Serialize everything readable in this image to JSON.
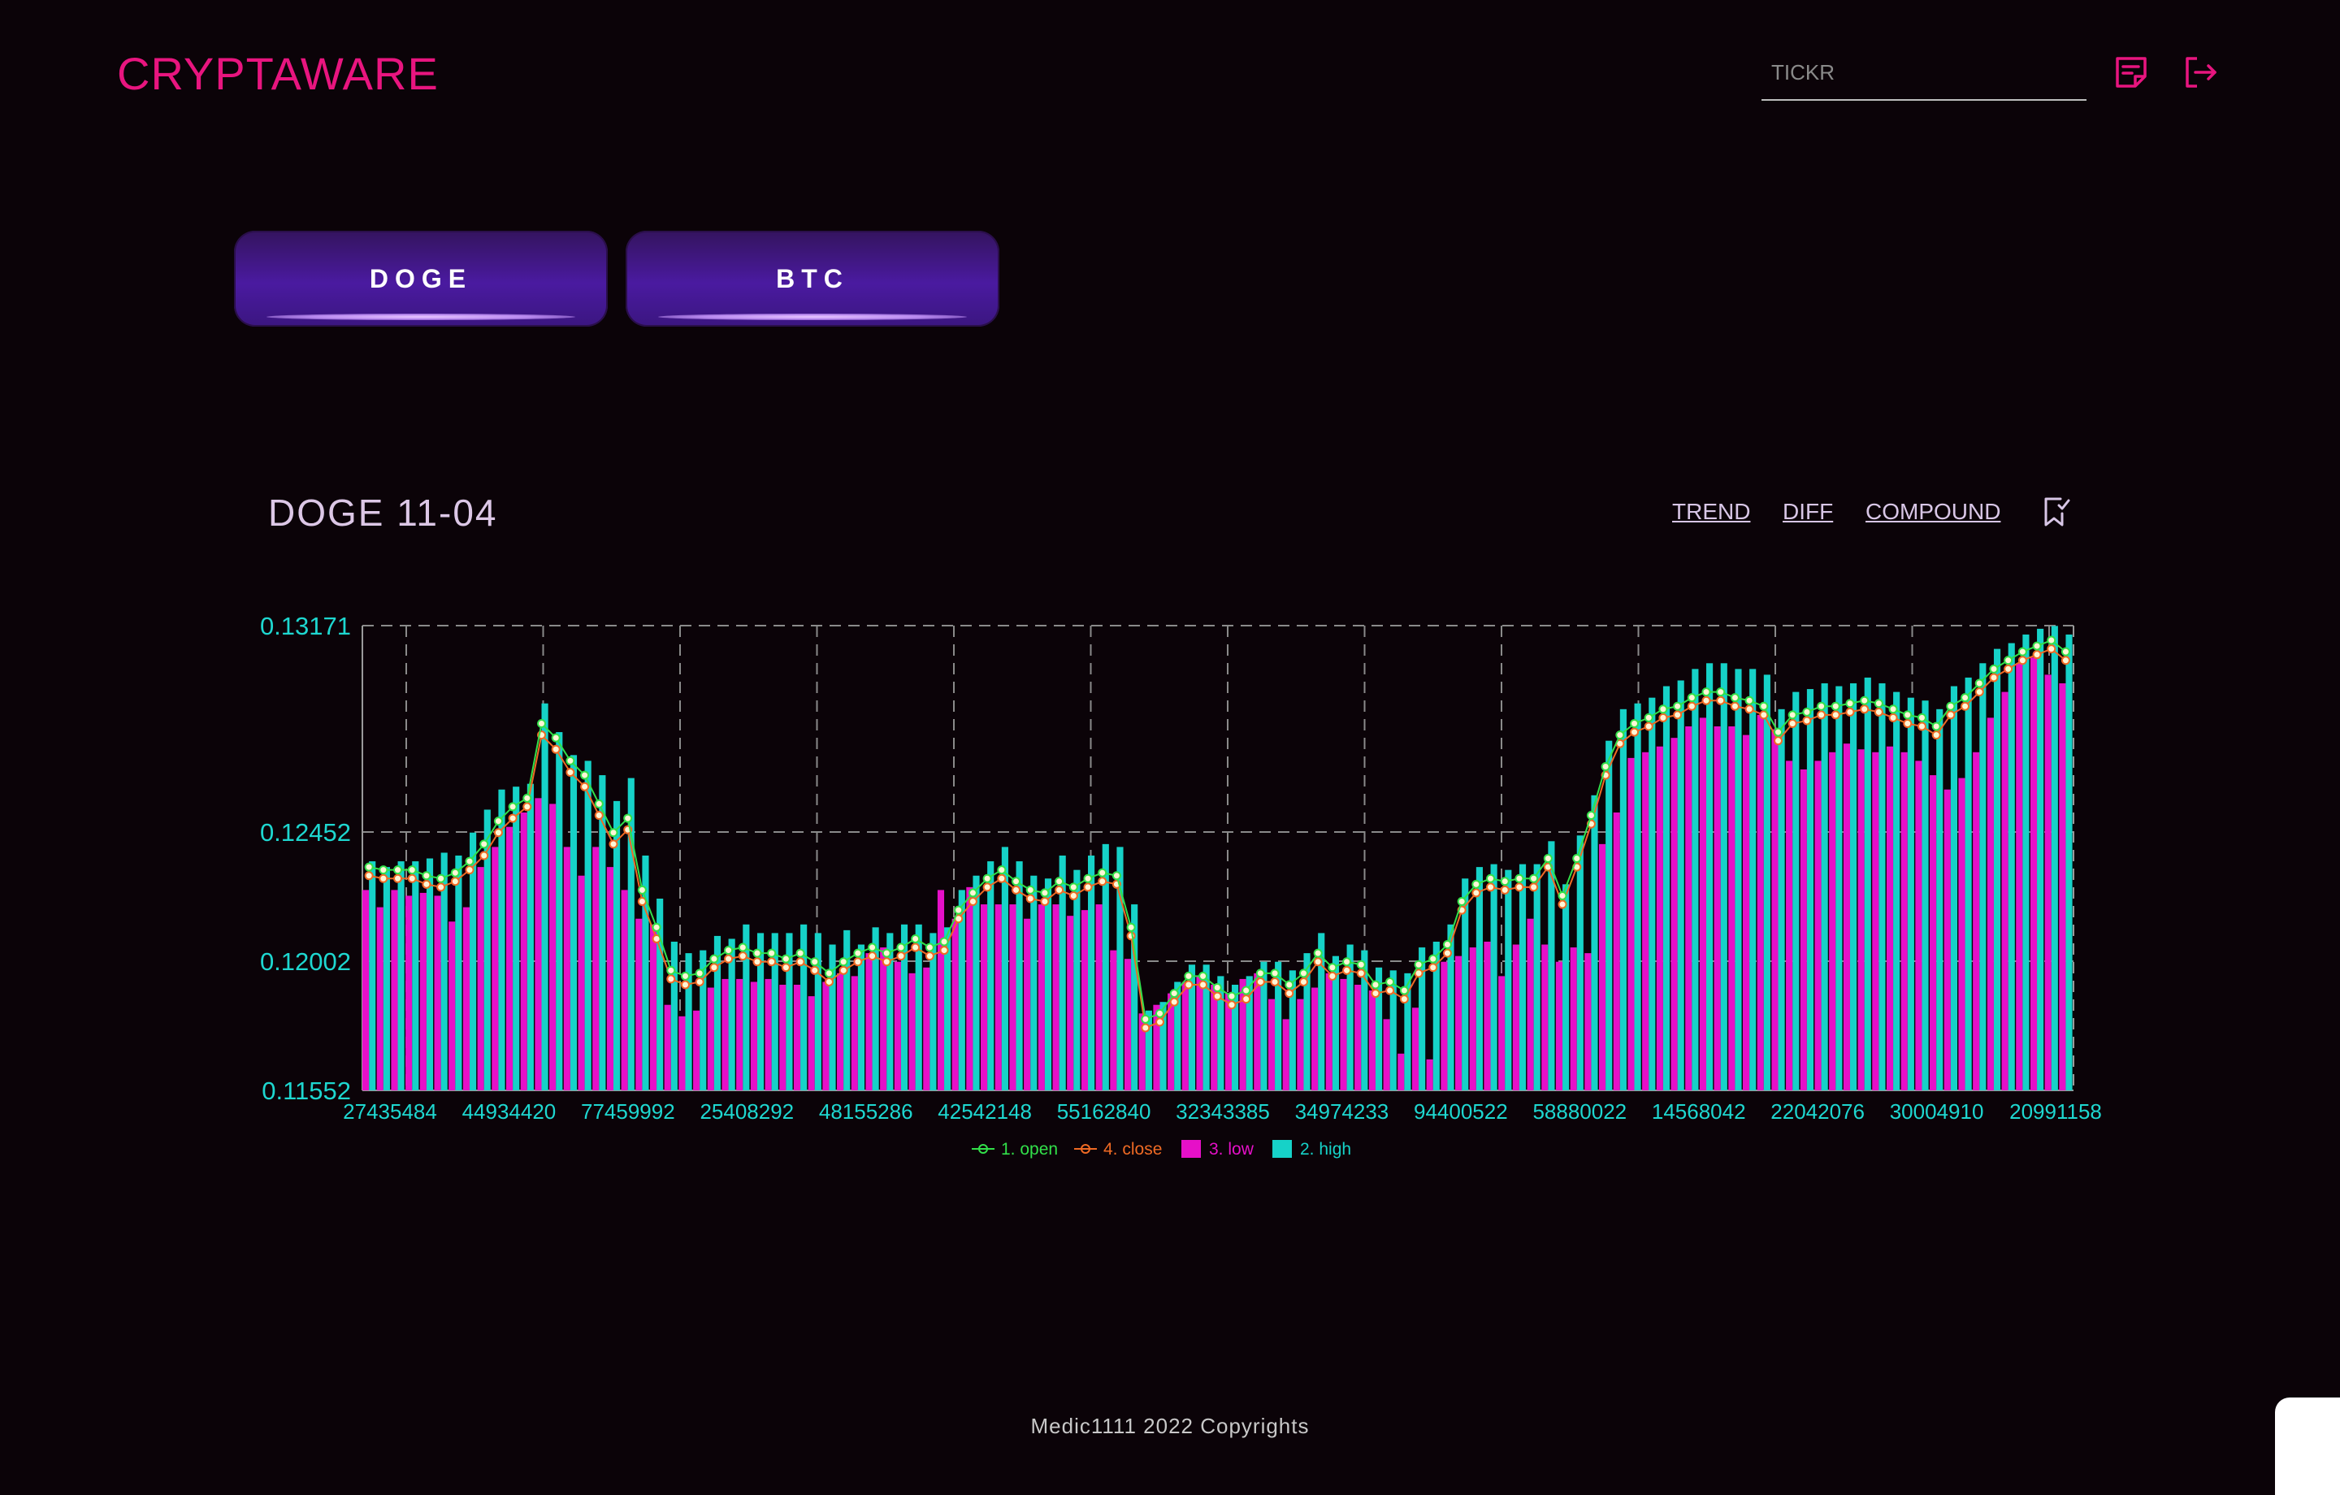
{
  "header": {
    "logo": "CRYPTAWARE",
    "search_placeholder": "TICKR"
  },
  "coins": [
    {
      "label": "DOGE"
    },
    {
      "label": "BTC"
    }
  ],
  "chart_header": {
    "title": "DOGE 11-04",
    "links": {
      "trend": "TREND",
      "diff": "DIFF",
      "compound": "COMPOUND"
    }
  },
  "footer": {
    "text": "Medic1111 2022 Copyrights"
  },
  "colors": {
    "brand": "#e8157f",
    "axis_text": "#1ed7d0",
    "open": "#32e04a",
    "close": "#ef6a24",
    "low": "#e610c8",
    "high": "#16d2c8"
  },
  "chart_data": {
    "type": "bar",
    "ylim": [
      0.11552,
      0.13171
    ],
    "y_ticks": [
      "0.11552",
      "0.12002",
      "0.12452",
      "0.13171"
    ],
    "x_tick_labels": [
      "27435484",
      "44934420",
      "77459992",
      "25408292",
      "48155286",
      "42542148",
      "55162840",
      "32343385",
      "34974233",
      "94400522",
      "58880022",
      "14568042",
      "22042076",
      "30004910",
      "20991158"
    ],
    "legend": [
      {
        "name": "1. open",
        "kind": "line"
      },
      {
        "name": "4. close",
        "kind": "line"
      },
      {
        "name": "3. low",
        "kind": "bar"
      },
      {
        "name": "2. high",
        "kind": "bar"
      }
    ],
    "series": [
      {
        "name": "3. low",
        "values": [
          0.1225,
          0.1219,
          0.1225,
          0.1223,
          0.1224,
          0.1223,
          0.1214,
          0.1219,
          0.1233,
          0.124,
          0.1247,
          0.1252,
          0.1257,
          0.1255,
          0.124,
          0.123,
          0.124,
          0.1233,
          0.1225,
          0.1215,
          0.1213,
          0.1185,
          0.1181,
          0.1183,
          0.1191,
          0.1194,
          0.1194,
          0.1193,
          0.1194,
          0.1192,
          0.1192,
          0.1188,
          0.1193,
          0.1196,
          0.1195,
          0.1203,
          0.1205,
          0.12,
          0.1196,
          0.1198,
          0.1225,
          0.1215,
          0.1226,
          0.122,
          0.122,
          0.122,
          0.1215,
          0.122,
          0.122,
          0.1216,
          0.1218,
          0.122,
          0.1204,
          0.1201,
          0.1182,
          0.1185,
          0.1189,
          0.1193,
          0.1195,
          0.1192,
          0.1189,
          0.1194,
          0.1196,
          0.1187,
          0.118,
          0.1187,
          0.1191,
          0.1196,
          0.1194,
          0.1192,
          0.119,
          0.118,
          0.1168,
          0.1184,
          0.1166,
          0.12,
          0.1202,
          0.1205,
          0.1207,
          0.1195,
          0.1206,
          0.1215,
          0.1206,
          0.12,
          0.1205,
          0.1203,
          0.1241,
          0.1252,
          0.1271,
          0.1273,
          0.1275,
          0.1278,
          0.1282,
          0.1285,
          0.1282,
          0.1282,
          0.1279,
          0.1286,
          0.1281,
          0.127,
          0.1267,
          0.127,
          0.1273,
          0.1276,
          0.1274,
          0.1273,
          0.1275,
          0.1273,
          0.127,
          0.1265,
          0.126,
          0.1264,
          0.1273,
          0.1285,
          0.1294,
          0.1304,
          0.1306,
          0.13,
          0.1297
        ]
      },
      {
        "name": "2. high",
        "values": [
          0.1235,
          0.1233,
          0.1235,
          0.1235,
          0.1236,
          0.1238,
          0.1237,
          0.1245,
          0.1253,
          0.126,
          0.1261,
          0.1262,
          0.129,
          0.128,
          0.1272,
          0.127,
          0.1265,
          0.1256,
          0.1264,
          0.1237,
          0.1222,
          0.1207,
          0.1203,
          0.1204,
          0.1209,
          0.1208,
          0.1213,
          0.121,
          0.121,
          0.121,
          0.1213,
          0.121,
          0.1206,
          0.1211,
          0.1206,
          0.1212,
          0.121,
          0.1213,
          0.1213,
          0.121,
          0.1212,
          0.1225,
          0.123,
          0.1235,
          0.124,
          0.1235,
          0.123,
          0.1229,
          0.1237,
          0.1232,
          0.1237,
          0.1241,
          0.124,
          0.122,
          0.1183,
          0.1186,
          0.1193,
          0.1199,
          0.1199,
          0.1195,
          0.1192,
          0.1195,
          0.12,
          0.12,
          0.1197,
          0.1203,
          0.121,
          0.1202,
          0.1206,
          0.1204,
          0.1198,
          0.1197,
          0.1196,
          0.1205,
          0.1207,
          0.1213,
          0.1229,
          0.1233,
          0.1234,
          0.1232,
          0.1234,
          0.1234,
          0.1242,
          0.1227,
          0.1244,
          0.1258,
          0.1277,
          0.1288,
          0.129,
          0.1292,
          0.1296,
          0.1298,
          0.1302,
          0.1304,
          0.1304,
          0.1302,
          0.1302,
          0.13,
          0.1288,
          0.1294,
          0.1295,
          0.1297,
          0.1296,
          0.1297,
          0.1299,
          0.1297,
          0.1294,
          0.1292,
          0.1291,
          0.1288,
          0.1296,
          0.1299,
          0.1304,
          0.1309,
          0.1311,
          0.1314,
          0.1316,
          0.1317,
          0.1314
        ]
      },
      {
        "name": "1. open",
        "values": [
          0.1233,
          0.1232,
          0.1232,
          0.1232,
          0.123,
          0.1229,
          0.1231,
          0.1235,
          0.1241,
          0.1249,
          0.1254,
          0.1257,
          0.1283,
          0.1278,
          0.127,
          0.1265,
          0.1255,
          0.1245,
          0.125,
          0.1225,
          0.1212,
          0.1197,
          0.1195,
          0.1196,
          0.1201,
          0.1204,
          0.1205,
          0.1203,
          0.1203,
          0.1201,
          0.1203,
          0.12,
          0.1196,
          0.12,
          0.1203,
          0.1205,
          0.1203,
          0.1205,
          0.1208,
          0.1205,
          0.1207,
          0.1218,
          0.1224,
          0.1229,
          0.1232,
          0.1228,
          0.1225,
          0.1224,
          0.1228,
          0.1226,
          0.1229,
          0.1231,
          0.123,
          0.1212,
          0.118,
          0.1182,
          0.1189,
          0.1195,
          0.1195,
          0.1191,
          0.1188,
          0.119,
          0.1196,
          0.1196,
          0.1192,
          0.1196,
          0.1203,
          0.1198,
          0.12,
          0.1199,
          0.1192,
          0.1193,
          0.119,
          0.1199,
          0.1201,
          0.1206,
          0.1221,
          0.1227,
          0.1229,
          0.1228,
          0.1229,
          0.1229,
          0.1236,
          0.1223,
          0.1236,
          0.1251,
          0.1268,
          0.1279,
          0.1283,
          0.1285,
          0.1288,
          0.1289,
          0.1292,
          0.1294,
          0.1294,
          0.1292,
          0.1291,
          0.1289,
          0.128,
          0.1286,
          0.1287,
          0.1289,
          0.1289,
          0.129,
          0.1291,
          0.129,
          0.1288,
          0.1286,
          0.1285,
          0.1282,
          0.1289,
          0.1292,
          0.1297,
          0.1302,
          0.1305,
          0.1308,
          0.131,
          0.1312,
          0.1308
        ]
      },
      {
        "name": "4. close",
        "values": [
          0.123,
          0.1229,
          0.1229,
          0.1229,
          0.1227,
          0.1226,
          0.1228,
          0.1232,
          0.1237,
          0.1245,
          0.125,
          0.1254,
          0.1279,
          0.1274,
          0.1266,
          0.1261,
          0.1251,
          0.1241,
          0.1246,
          0.1221,
          0.1208,
          0.1194,
          0.1192,
          0.1193,
          0.1198,
          0.1201,
          0.1202,
          0.12,
          0.12,
          0.1198,
          0.12,
          0.1197,
          0.1193,
          0.1197,
          0.12,
          0.1202,
          0.12,
          0.1202,
          0.1205,
          0.1202,
          0.1204,
          0.1215,
          0.1221,
          0.1226,
          0.1229,
          0.1225,
          0.1222,
          0.1221,
          0.1225,
          0.1223,
          0.1226,
          0.1228,
          0.1227,
          0.1209,
          0.1177,
          0.1179,
          0.1186,
          0.1192,
          0.1192,
          0.1188,
          0.1185,
          0.1187,
          0.1193,
          0.1193,
          0.1189,
          0.1193,
          0.12,
          0.1195,
          0.1197,
          0.1196,
          0.1189,
          0.119,
          0.1187,
          0.1196,
          0.1198,
          0.1203,
          0.1218,
          0.1224,
          0.1226,
          0.1225,
          0.1226,
          0.1226,
          0.1233,
          0.122,
          0.1233,
          0.1248,
          0.1265,
          0.1276,
          0.128,
          0.1282,
          0.1285,
          0.1286,
          0.1289,
          0.1291,
          0.1291,
          0.1289,
          0.1288,
          0.1286,
          0.1277,
          0.1283,
          0.1284,
          0.1286,
          0.1286,
          0.1287,
          0.1288,
          0.1287,
          0.1285,
          0.1283,
          0.1282,
          0.1279,
          0.1286,
          0.1289,
          0.1294,
          0.1299,
          0.1302,
          0.1305,
          0.1307,
          0.1309,
          0.1305
        ]
      }
    ]
  }
}
